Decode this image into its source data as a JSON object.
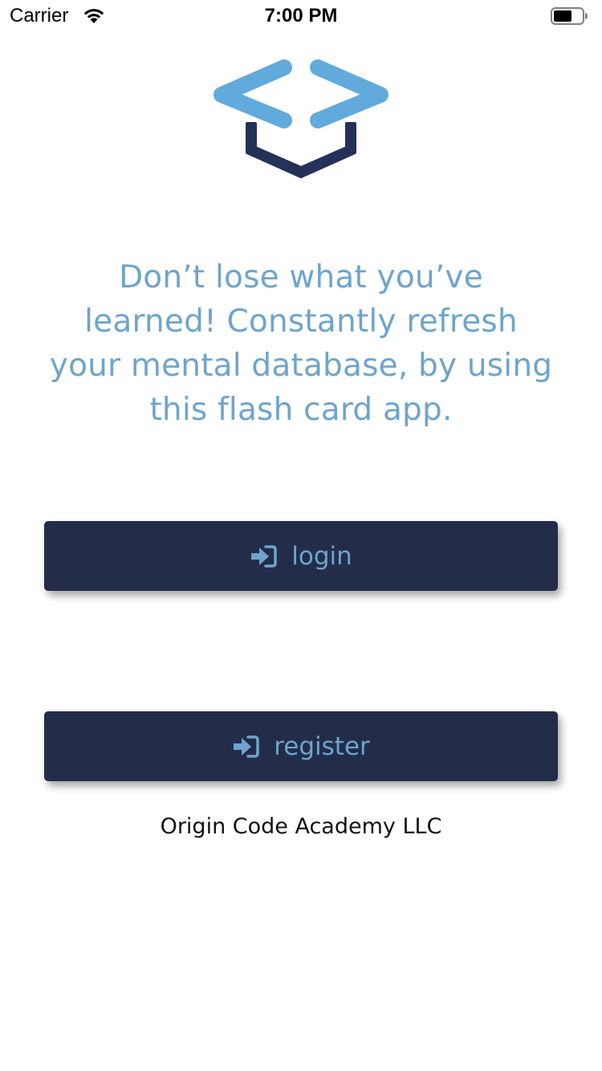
{
  "status_bar": {
    "carrier": "Carrier",
    "time": "7:00 PM",
    "icons": [
      "wifi-icon",
      "battery-icon"
    ]
  },
  "logo": {
    "icon": "graduation-cap-code-logo",
    "colors": {
      "brackets": "#62aadc",
      "cap": "#24325a"
    }
  },
  "tagline": "Don’t lose what you’ve learned! Constantly refresh your mental database, by using this flash card app.",
  "buttons": {
    "login": {
      "label": "login",
      "icon": "sign-in-icon"
    },
    "register": {
      "label": "register",
      "icon": "sign-in-icon"
    }
  },
  "footer": "Origin Code Academy LLC",
  "colors": {
    "button_background": "#232d4a",
    "accent_text": "#6fa4cc"
  }
}
